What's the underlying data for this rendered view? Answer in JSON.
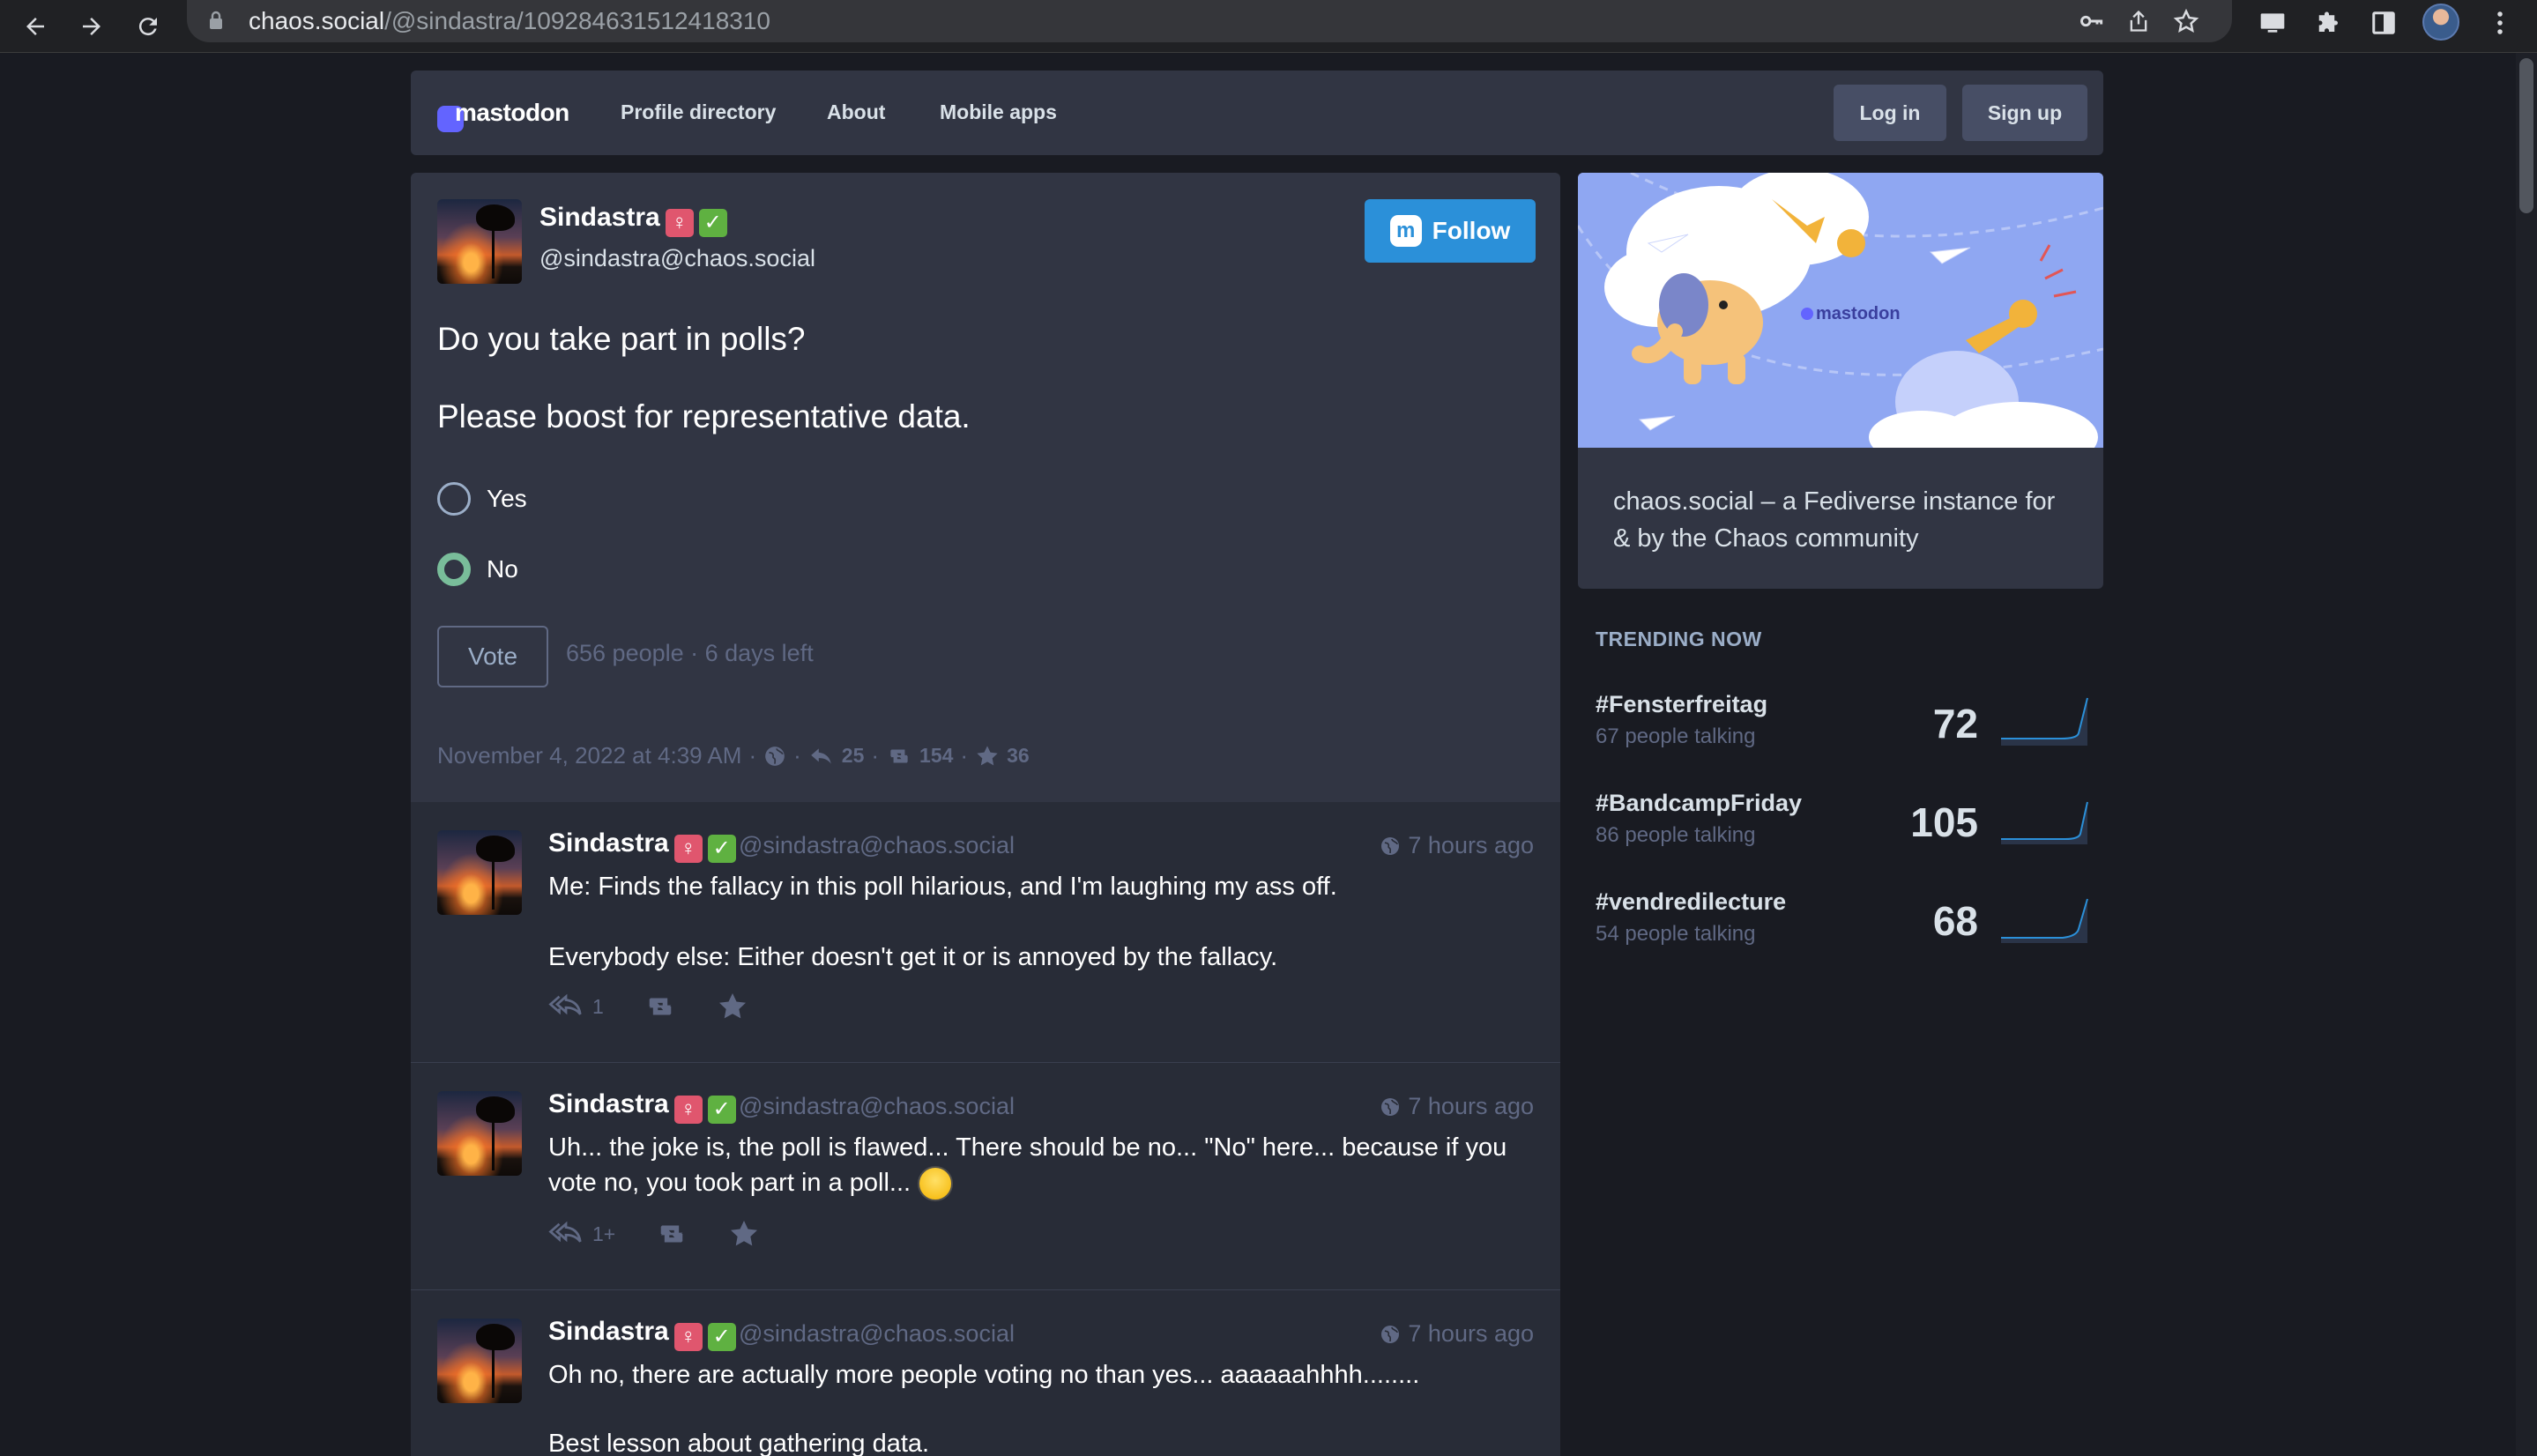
{
  "browser": {
    "url_host": "chaos.social",
    "url_path": "/@sindastra/109284631512418310"
  },
  "header": {
    "logo_text": "mastodon",
    "nav": [
      "Profile directory",
      "About",
      "Mobile apps"
    ],
    "login_label": "Log in",
    "signup_label": "Sign up"
  },
  "status": {
    "display_name": "Sindastra",
    "badge_female": "♀",
    "badge_check": "✓",
    "acct": "@sindastra@chaos.social",
    "follow_label": "Follow",
    "text_line1": "Do you take part in polls?",
    "text_line2": "Please boost for representative data.",
    "poll": {
      "options": [
        {
          "label": "Yes",
          "selected": false
        },
        {
          "label": "No",
          "selected": true
        }
      ],
      "vote_label": "Vote",
      "meta": "656 people · 6 days left"
    },
    "meta": {
      "date": "November 4, 2022 at 4:39 AM",
      "replies": "25",
      "boosts": "154",
      "favourites": "36"
    }
  },
  "replies": [
    {
      "display_name": "Sindastra",
      "acct": "@sindastra@chaos.social",
      "time": "7 hours ago",
      "lines": [
        "Me: Finds the fallacy in this poll hilarious, and I'm laughing my ass off.",
        "Everybody else: Either doesn't get it or is annoyed by the fallacy."
      ],
      "reply_count": "1"
    },
    {
      "display_name": "Sindastra",
      "acct": "@sindastra@chaos.social",
      "time": "7 hours ago",
      "lines": [
        "Uh... the joke is, the poll is flawed... There should be no... \"No\" here... because if you",
        "vote no, you took part in a poll..."
      ],
      "reply_count": "1+"
    },
    {
      "display_name": "Sindastra",
      "acct": "@sindastra@chaos.social",
      "time": "7 hours ago",
      "lines": [
        "Oh no, there are actually more people voting no than yes... aaaaaahhhh........",
        "Best lesson about gathering data."
      ]
    }
  ],
  "sidebar": {
    "hero_logo_text": "mastodon",
    "description": "chaos.social – a Fediverse instance for & by the Chaos community",
    "trending_title": "TRENDING NOW",
    "trends": [
      {
        "tag": "#Fensterfreitag",
        "talking": "67 people talking",
        "count": "72"
      },
      {
        "tag": "#BandcampFriday",
        "talking": "86 people talking",
        "count": "105"
      },
      {
        "tag": "#vendredilecture",
        "talking": "54 people talking",
        "count": "68"
      }
    ]
  },
  "colors": {
    "background": "#191b22",
    "panel": "#313543",
    "accent_blue": "#2b90d9",
    "poll_selected": "#79bd9a"
  }
}
